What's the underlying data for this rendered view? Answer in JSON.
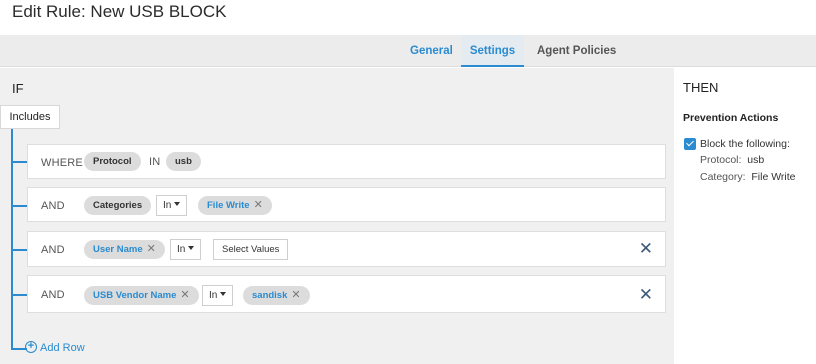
{
  "page": {
    "title": "Edit Rule: New USB BLOCK"
  },
  "tabs": [
    {
      "label": "General",
      "active": false
    },
    {
      "label": "Settings",
      "active": true
    },
    {
      "label": "Agent Policies",
      "active": false
    }
  ],
  "if_section": {
    "label": "IF",
    "includes_label": "Includes",
    "rows": [
      {
        "keyword": "WHERE",
        "field": "Protocol",
        "operator": "IN",
        "values": [
          "usb"
        ]
      },
      {
        "keyword": "AND",
        "field": "Categories",
        "operator": "In",
        "values": [
          "File Write"
        ]
      },
      {
        "keyword": "AND",
        "field": "User Name",
        "operator": "In",
        "placeholder": "Select Values"
      },
      {
        "keyword": "AND",
        "field": "USB Vendor Name",
        "operator": "In",
        "values": [
          "sandisk"
        ]
      }
    ],
    "add_row_label": "Add Row"
  },
  "then_section": {
    "label": "THEN",
    "prevention_label": "Prevention Actions",
    "block_label": "Block the following:",
    "details": [
      {
        "key": "Protocol:",
        "value": "usb"
      },
      {
        "key": "Category:",
        "value": "File Write"
      }
    ]
  },
  "colors": {
    "accent": "#2a8bd0",
    "panel_bg": "#f0f0f0",
    "tab_bar_bg": "#ececec"
  },
  "icons": {
    "remove": "close-icon",
    "add": "plus-circle-icon",
    "dropdown": "caret-down-icon",
    "checkbox": "checkmark-icon"
  }
}
